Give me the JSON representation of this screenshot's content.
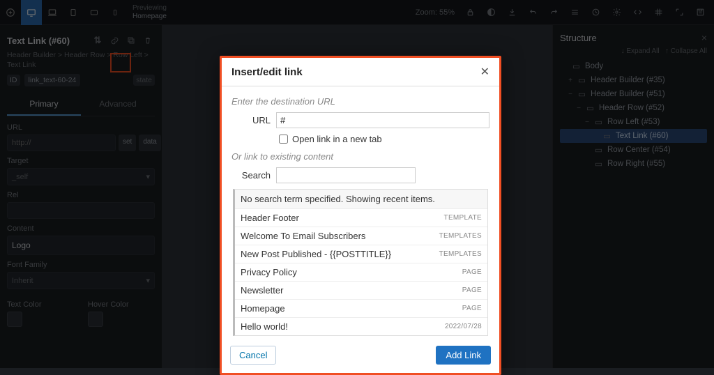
{
  "topbar": {
    "preview_label": "Previewing",
    "preview_value": "Homepage",
    "zoom_label": "Zoom: 55%"
  },
  "left": {
    "title": "Text Link (#60)",
    "breadcrumb": "Header Builder  >  Header Row  >  Row Left  >  Text Link",
    "id_chip": "ID",
    "name_chip": "link_text-60-24",
    "state_chip": "state",
    "tab_primary": "Primary",
    "tab_advanced": "Advanced",
    "url_label": "URL",
    "url_placeholder": "http://",
    "set_btn": "set",
    "data_btn": "data",
    "target_label": "Target",
    "target_value": "_self",
    "rel_label": "Rel",
    "content_label": "Content",
    "content_value": "Logo",
    "fontfamily_label": "Font Family",
    "fontfamily_value": "Inherit",
    "textcolor_label": "Text Color",
    "hovercolor_label": "Hover Color"
  },
  "right": {
    "title": "Structure",
    "expand": "↓ Expand All",
    "collapse": "↑ Collapse All",
    "tree": [
      {
        "label": "Body",
        "indent": 0,
        "twisty": ""
      },
      {
        "label": "Header Builder (#35)",
        "indent": 1,
        "twisty": "+"
      },
      {
        "label": "Header Builder (#51)",
        "indent": 1,
        "twisty": "−"
      },
      {
        "label": "Header Row (#52)",
        "indent": 2,
        "twisty": "−"
      },
      {
        "label": "Row Left (#53)",
        "indent": 3,
        "twisty": "−"
      },
      {
        "label": "Text Link (#60)",
        "indent": 4,
        "twisty": "",
        "selected": true
      },
      {
        "label": "Row Center (#54)",
        "indent": 3,
        "twisty": ""
      },
      {
        "label": "Row Right (#55)",
        "indent": 3,
        "twisty": ""
      }
    ]
  },
  "modal": {
    "title": "Insert/edit link",
    "dest_label": "Enter the destination URL",
    "url_label": "URL",
    "url_value": "#",
    "newtab_label": "Open link in a new tab",
    "or_label": "Or link to existing content",
    "search_label": "Search",
    "no_term": "No search term specified. Showing recent items.",
    "items": [
      {
        "title": "Header Footer",
        "tag": "TEMPLATE"
      },
      {
        "title": "Welcome To Email Subscribers",
        "tag": "TEMPLATES"
      },
      {
        "title": "New Post Published - {{POSTTITLE}}",
        "tag": "TEMPLATES"
      },
      {
        "title": "Privacy Policy",
        "tag": "PAGE"
      },
      {
        "title": "Newsletter",
        "tag": "PAGE"
      },
      {
        "title": "Homepage",
        "tag": "PAGE"
      },
      {
        "title": "Hello world!",
        "tag": "2022/07/28"
      }
    ],
    "cancel": "Cancel",
    "add": "Add Link"
  }
}
